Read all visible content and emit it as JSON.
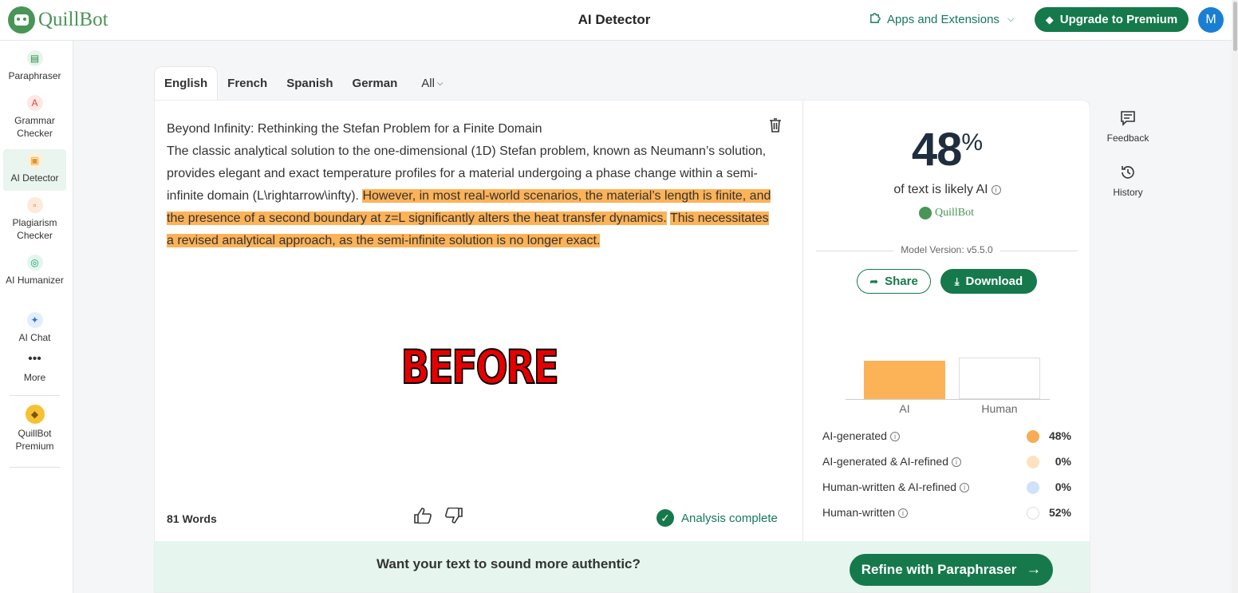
{
  "app": {
    "logo_text": "QuillBot",
    "page_title": "AI Detector"
  },
  "header": {
    "apps_label": "Apps and Extensions",
    "upgrade_label": "Upgrade to Premium",
    "avatar_initial": "M"
  },
  "sidebar": {
    "items": [
      {
        "label": "Paraphraser",
        "icon": "paraphraser-icon"
      },
      {
        "label": "Grammar Checker",
        "icon": "grammar-checker-icon"
      },
      {
        "label": "AI Detector",
        "icon": "ai-detector-icon"
      },
      {
        "label": "Plagiarism Checker",
        "icon": "plagiarism-checker-icon"
      },
      {
        "label": "AI Humanizer",
        "icon": "ai-humanizer-icon"
      },
      {
        "label": "AI Chat",
        "icon": "ai-chat-icon"
      },
      {
        "label": "More",
        "icon": "more-icon"
      },
      {
        "label": "QuillBot Premium",
        "icon": "premium-gem-icon"
      }
    ],
    "active": "AI Detector"
  },
  "tabs": {
    "items": [
      "English",
      "French",
      "Spanish",
      "German"
    ],
    "active": "English",
    "all_label": "All"
  },
  "document": {
    "title_line": "Beyond Infinity: Rethinking the Stefan Problem for a Finite Domain",
    "plain_text": "The classic analytical solution to the one-dimensional (1D) Stefan problem, known as Neumann’s solution, provides elegant and exact temperature profiles for a material undergoing a phase change within a semi-infinite domain (L\\rightarrow\\infty).",
    "highlight_1": "However, in most real-world scenarios, the material’s length is finite, and the presence of a second boundary at z=L significantly alters the heat transfer dynamics.",
    "highlight_2": "This necessitates a revised analytical approach, as the semi-infinite solution is no longer exact.",
    "overlay_text": "BEFORE",
    "word_count": "81 Words",
    "status": "Analysis complete"
  },
  "results": {
    "score": "48",
    "score_suffix": "%",
    "likely_text": "of text is likely AI",
    "brand": "QuillBot",
    "model_version": "Model Version: v5.5.0",
    "share_label": "Share",
    "download_label": "Download"
  },
  "chart_data": {
    "type": "bar",
    "categories": [
      "AI",
      "Human"
    ],
    "values": [
      48,
      52
    ],
    "colors": [
      "#fcb257",
      "#ffffff"
    ]
  },
  "breakdown": [
    {
      "label": "AI-generated",
      "value": "48%",
      "color": "#f6ad55"
    },
    {
      "label": "AI-generated & AI-refined",
      "value": "0%",
      "color": "#fde2c0"
    },
    {
      "label": "Human-written & AI-refined",
      "value": "0%",
      "color": "#cfe2fb"
    },
    {
      "label": "Human-written",
      "value": "52%",
      "color": "#ffffff"
    }
  ],
  "banner": {
    "message": "Want your text to sound more authentic?",
    "cta_label": "Refine with Paraphraser"
  },
  "rail": {
    "feedback_label": "Feedback",
    "history_label": "History"
  },
  "colors": {
    "brand_green": "#15794b",
    "highlight": "#fcb257",
    "logo_green": "#499557"
  }
}
